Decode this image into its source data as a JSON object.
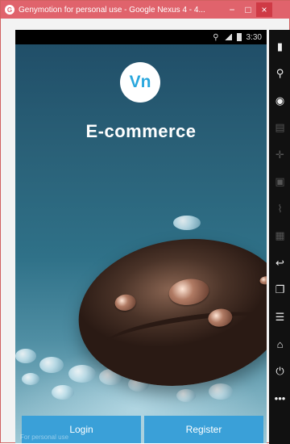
{
  "window": {
    "title": "Genymotion for personal use - Google Nexus 4 - 4...",
    "minimize_label": "−",
    "maximize_label": "□",
    "close_label": "×"
  },
  "status_bar": {
    "time": "3:30"
  },
  "app": {
    "logo_text": "Vn",
    "heading": "E-commerce",
    "login_label": "Login",
    "register_label": "Register",
    "watermark": "For personal use"
  },
  "toolbar": {
    "items": [
      {
        "name": "battery-icon",
        "glyph": "▮"
      },
      {
        "name": "gps-icon",
        "glyph": "⚲"
      },
      {
        "name": "camera-icon",
        "glyph": "◉"
      },
      {
        "name": "id-icon",
        "glyph": "▤"
      },
      {
        "name": "dpad-icon",
        "glyph": "✛"
      },
      {
        "name": "screenshot-icon",
        "glyph": "▣"
      },
      {
        "name": "wifi-icon",
        "glyph": "⌇"
      },
      {
        "name": "phone-icon",
        "glyph": "▦"
      },
      {
        "name": "back-icon",
        "glyph": "↩"
      },
      {
        "name": "recent-apps-icon",
        "glyph": "❐"
      },
      {
        "name": "menu-icon",
        "glyph": "☰"
      },
      {
        "name": "home-icon",
        "glyph": "⌂"
      },
      {
        "name": "power-icon",
        "glyph": "⏻"
      },
      {
        "name": "more-icon",
        "glyph": "•••"
      }
    ]
  }
}
